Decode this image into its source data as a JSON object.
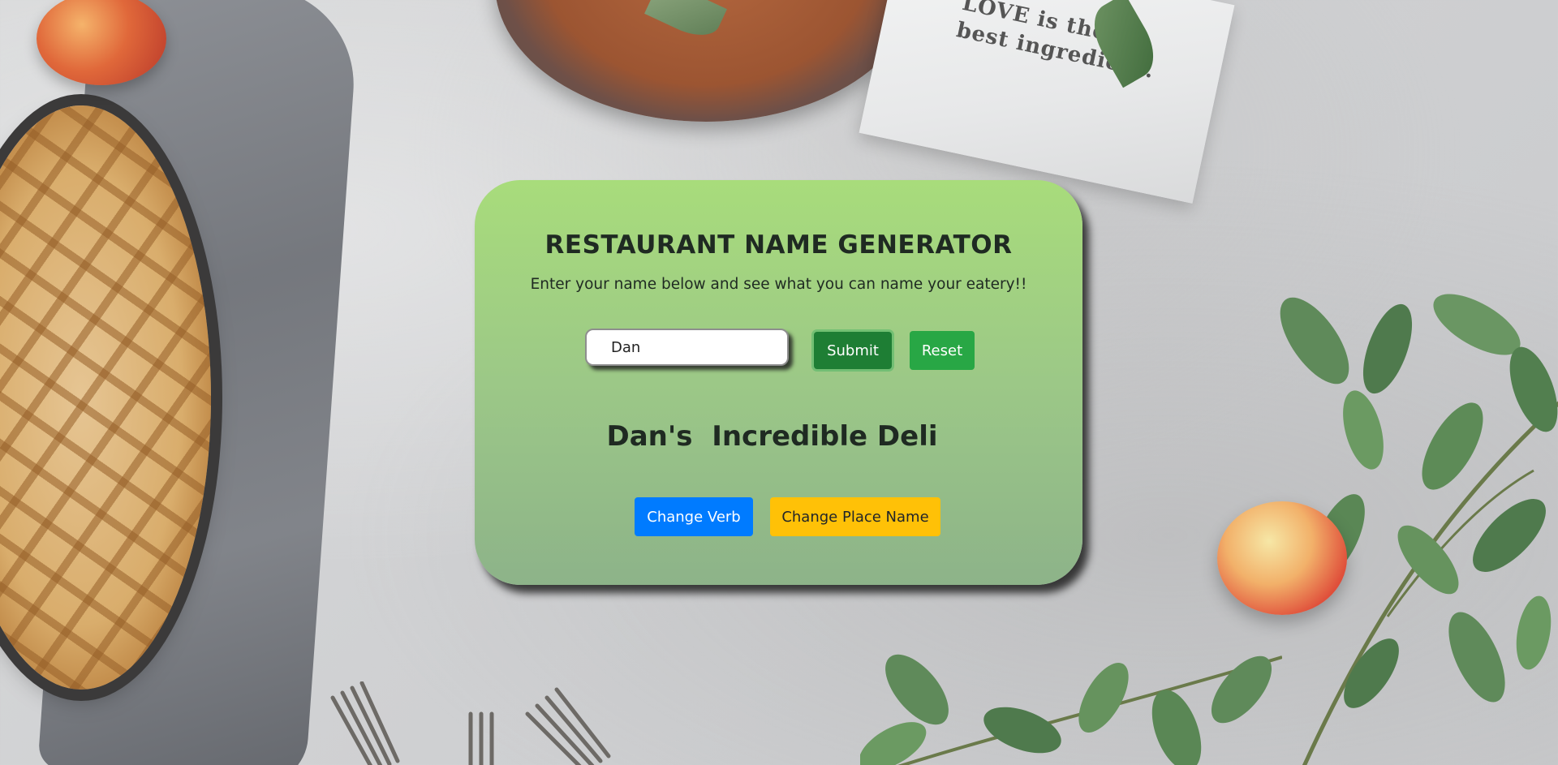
{
  "background": {
    "napkin_text_line1": "LOVE is the",
    "napkin_text_line2": "best ingredient."
  },
  "card": {
    "title": "RESTAURANT NAME GENERATOR",
    "subtitle": "Enter your name below and see what you can name your eatery!!",
    "name_input_value": "Dan",
    "submit_label": "Submit",
    "reset_label": "Reset",
    "result": "Dan's  Incredible Deli",
    "change_verb_label": "Change Verb",
    "change_place_label": "Change Place Name"
  },
  "colors": {
    "card_top": "#a8dc7b",
    "card_bottom": "#8db389",
    "submit": "#1e7e34",
    "reset": "#28a745",
    "change_verb": "#007bff",
    "change_place": "#ffc107"
  }
}
